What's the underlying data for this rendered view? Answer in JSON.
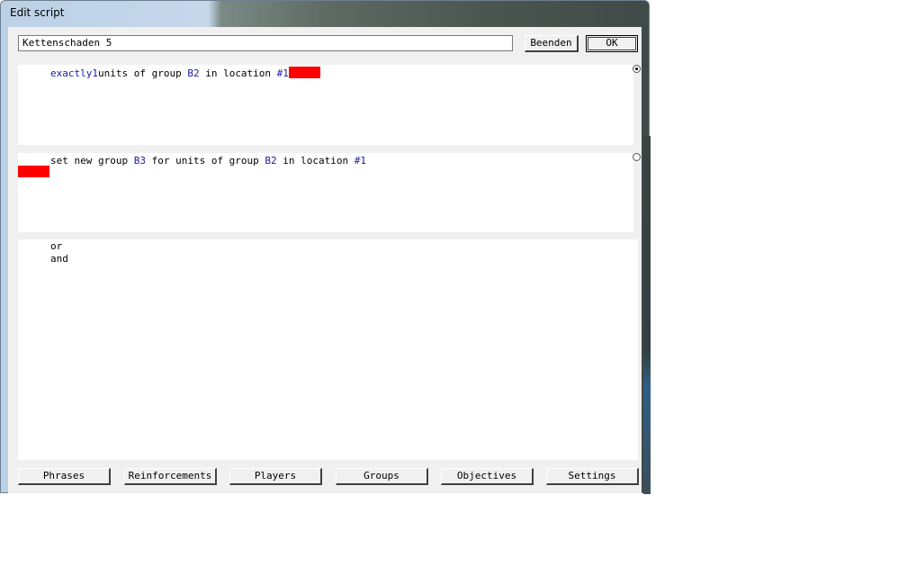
{
  "window": {
    "title": "Edit script"
  },
  "header": {
    "name_value": "Kettenschaden 5",
    "beenden_label": "Beenden",
    "ok_label": "OK"
  },
  "condition": {
    "exactly": "exactly",
    "count": "1",
    "text1": "units of group ",
    "group": "B2",
    "text2": " in location ",
    "location": "#1"
  },
  "action": {
    "text1": "set new group ",
    "new_group": "B3",
    "text2": " for units of group ",
    "group": "B2",
    "text3": " in location ",
    "location": "#1"
  },
  "logic_options": [
    "or",
    "and"
  ],
  "tabs": {
    "phrases": "Phrases",
    "reinforcements": "Reinforcements",
    "players": "Players",
    "groups": "Groups",
    "objectives": "Objectives",
    "settings": "Settings"
  },
  "colors": {
    "link": "#1a1aa6",
    "placeholder": "#ff0000"
  }
}
